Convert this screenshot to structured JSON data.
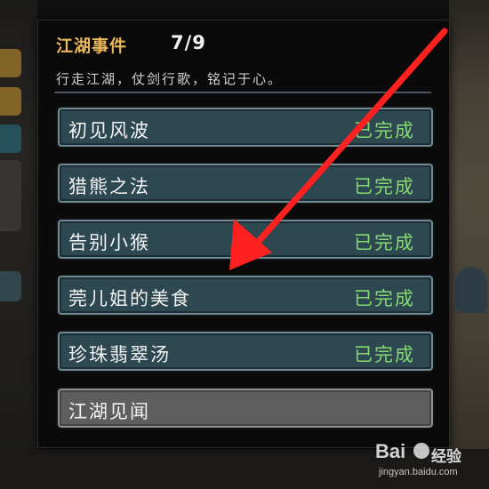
{
  "panel": {
    "title": "江湖事件",
    "count": "7/9",
    "subtitle": "行走江湖，仗剑行歌，铭记于心。"
  },
  "events": [
    {
      "name": "初见风波",
      "status": "已完成",
      "completed": true
    },
    {
      "name": "猎熊之法",
      "status": "已完成",
      "completed": true
    },
    {
      "name": "告别小猴",
      "status": "已完成",
      "completed": true
    },
    {
      "name": "莞儿姐的美食",
      "status": "已完成",
      "completed": true
    },
    {
      "name": "珍珠翡翠汤",
      "status": "已完成",
      "completed": true
    },
    {
      "name": "江湖见闻",
      "status": "",
      "completed": false
    }
  ],
  "colors": {
    "title": "#e9b85a",
    "completed_status": "#86d873",
    "item_bg": "#2e4851",
    "locked_bg": "#5e5e5e",
    "arrow": "#ff2020"
  },
  "watermark": {
    "logo": "Bai",
    "brand": "经验",
    "url": "jingyan.baidu.com"
  }
}
